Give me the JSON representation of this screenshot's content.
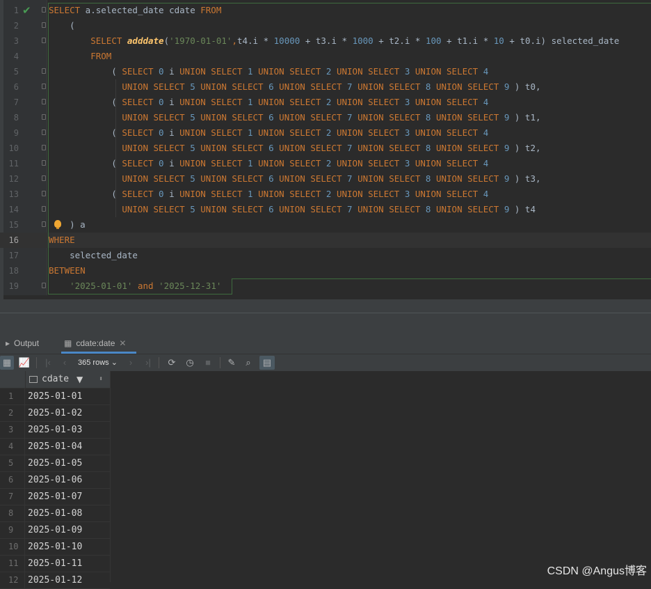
{
  "editor": {
    "lines": [
      {
        "n": "1",
        "tokens": [
          {
            "t": "SELECT",
            "c": "kw"
          },
          {
            "t": " a.selected_date cdate "
          },
          {
            "t": "FROM",
            "c": "kw"
          }
        ]
      },
      {
        "n": "2",
        "tokens": [
          {
            "t": "    ("
          }
        ]
      },
      {
        "n": "3",
        "tokens": [
          {
            "t": "        "
          },
          {
            "t": "SELECT",
            "c": "kw"
          },
          {
            "t": " "
          },
          {
            "t": "adddate",
            "c": "fn"
          },
          {
            "t": "("
          },
          {
            "t": "'1970-01-01'",
            "c": "str"
          },
          {
            "t": ",",
            "c": "kw"
          },
          {
            "t": "t4.i * "
          },
          {
            "t": "10000",
            "c": "num"
          },
          {
            "t": " + t3.i * "
          },
          {
            "t": "1000",
            "c": "num"
          },
          {
            "t": " + t2.i * "
          },
          {
            "t": "100",
            "c": "num"
          },
          {
            "t": " + t1.i * "
          },
          {
            "t": "10",
            "c": "num"
          },
          {
            "t": " + t0.i) selected_date"
          }
        ]
      },
      {
        "n": "4",
        "tokens": [
          {
            "t": "        "
          },
          {
            "t": "FROM",
            "c": "kw"
          }
        ]
      },
      {
        "n": "5",
        "tokens": [
          {
            "t": "            ( "
          },
          {
            "t": "SELECT",
            "c": "kw"
          },
          {
            "t": " "
          },
          {
            "t": "0",
            "c": "num"
          },
          {
            "t": " i "
          },
          {
            "t": "UNION SELECT",
            "c": "kw"
          },
          {
            "t": " "
          },
          {
            "t": "1",
            "c": "num"
          },
          {
            "t": " "
          },
          {
            "t": "UNION SELECT",
            "c": "kw"
          },
          {
            "t": " "
          },
          {
            "t": "2",
            "c": "num"
          },
          {
            "t": " "
          },
          {
            "t": "UNION SELECT",
            "c": "kw"
          },
          {
            "t": " "
          },
          {
            "t": "3",
            "c": "num"
          },
          {
            "t": " "
          },
          {
            "t": "UNION SELECT",
            "c": "kw"
          },
          {
            "t": " "
          },
          {
            "t": "4",
            "c": "num"
          }
        ]
      },
      {
        "n": "6",
        "tokens": [
          {
            "t": "              "
          },
          {
            "t": "UNION SELECT",
            "c": "kw"
          },
          {
            "t": " "
          },
          {
            "t": "5",
            "c": "num"
          },
          {
            "t": " "
          },
          {
            "t": "UNION SELECT",
            "c": "kw"
          },
          {
            "t": " "
          },
          {
            "t": "6",
            "c": "num"
          },
          {
            "t": " "
          },
          {
            "t": "UNION SELECT",
            "c": "kw"
          },
          {
            "t": " "
          },
          {
            "t": "7",
            "c": "num"
          },
          {
            "t": " "
          },
          {
            "t": "UNION SELECT",
            "c": "kw"
          },
          {
            "t": " "
          },
          {
            "t": "8",
            "c": "num"
          },
          {
            "t": " "
          },
          {
            "t": "UNION SELECT",
            "c": "kw"
          },
          {
            "t": " "
          },
          {
            "t": "9",
            "c": "num"
          },
          {
            "t": " ) t0,"
          }
        ]
      },
      {
        "n": "7",
        "tokens": [
          {
            "t": "            ( "
          },
          {
            "t": "SELECT",
            "c": "kw"
          },
          {
            "t": " "
          },
          {
            "t": "0",
            "c": "num"
          },
          {
            "t": " i "
          },
          {
            "t": "UNION SELECT",
            "c": "kw"
          },
          {
            "t": " "
          },
          {
            "t": "1",
            "c": "num"
          },
          {
            "t": " "
          },
          {
            "t": "UNION SELECT",
            "c": "kw"
          },
          {
            "t": " "
          },
          {
            "t": "2",
            "c": "num"
          },
          {
            "t": " "
          },
          {
            "t": "UNION SELECT",
            "c": "kw"
          },
          {
            "t": " "
          },
          {
            "t": "3",
            "c": "num"
          },
          {
            "t": " "
          },
          {
            "t": "UNION SELECT",
            "c": "kw"
          },
          {
            "t": " "
          },
          {
            "t": "4",
            "c": "num"
          }
        ]
      },
      {
        "n": "8",
        "tokens": [
          {
            "t": "              "
          },
          {
            "t": "UNION SELECT",
            "c": "kw"
          },
          {
            "t": " "
          },
          {
            "t": "5",
            "c": "num"
          },
          {
            "t": " "
          },
          {
            "t": "UNION SELECT",
            "c": "kw"
          },
          {
            "t": " "
          },
          {
            "t": "6",
            "c": "num"
          },
          {
            "t": " "
          },
          {
            "t": "UNION SELECT",
            "c": "kw"
          },
          {
            "t": " "
          },
          {
            "t": "7",
            "c": "num"
          },
          {
            "t": " "
          },
          {
            "t": "UNION SELECT",
            "c": "kw"
          },
          {
            "t": " "
          },
          {
            "t": "8",
            "c": "num"
          },
          {
            "t": " "
          },
          {
            "t": "UNION SELECT",
            "c": "kw"
          },
          {
            "t": " "
          },
          {
            "t": "9",
            "c": "num"
          },
          {
            "t": " ) t1,"
          }
        ]
      },
      {
        "n": "9",
        "tokens": [
          {
            "t": "            ( "
          },
          {
            "t": "SELECT",
            "c": "kw"
          },
          {
            "t": " "
          },
          {
            "t": "0",
            "c": "num"
          },
          {
            "t": " i "
          },
          {
            "t": "UNION SELECT",
            "c": "kw"
          },
          {
            "t": " "
          },
          {
            "t": "1",
            "c": "num"
          },
          {
            "t": " "
          },
          {
            "t": "UNION SELECT",
            "c": "kw"
          },
          {
            "t": " "
          },
          {
            "t": "2",
            "c": "num"
          },
          {
            "t": " "
          },
          {
            "t": "UNION SELECT",
            "c": "kw"
          },
          {
            "t": " "
          },
          {
            "t": "3",
            "c": "num"
          },
          {
            "t": " "
          },
          {
            "t": "UNION SELECT",
            "c": "kw"
          },
          {
            "t": " "
          },
          {
            "t": "4",
            "c": "num"
          }
        ]
      },
      {
        "n": "10",
        "tokens": [
          {
            "t": "              "
          },
          {
            "t": "UNION SELECT",
            "c": "kw"
          },
          {
            "t": " "
          },
          {
            "t": "5",
            "c": "num"
          },
          {
            "t": " "
          },
          {
            "t": "UNION SELECT",
            "c": "kw"
          },
          {
            "t": " "
          },
          {
            "t": "6",
            "c": "num"
          },
          {
            "t": " "
          },
          {
            "t": "UNION SELECT",
            "c": "kw"
          },
          {
            "t": " "
          },
          {
            "t": "7",
            "c": "num"
          },
          {
            "t": " "
          },
          {
            "t": "UNION SELECT",
            "c": "kw"
          },
          {
            "t": " "
          },
          {
            "t": "8",
            "c": "num"
          },
          {
            "t": " "
          },
          {
            "t": "UNION SELECT",
            "c": "kw"
          },
          {
            "t": " "
          },
          {
            "t": "9",
            "c": "num"
          },
          {
            "t": " ) t2,"
          }
        ]
      },
      {
        "n": "11",
        "tokens": [
          {
            "t": "            ( "
          },
          {
            "t": "SELECT",
            "c": "kw"
          },
          {
            "t": " "
          },
          {
            "t": "0",
            "c": "num"
          },
          {
            "t": " i "
          },
          {
            "t": "UNION SELECT",
            "c": "kw"
          },
          {
            "t": " "
          },
          {
            "t": "1",
            "c": "num"
          },
          {
            "t": " "
          },
          {
            "t": "UNION SELECT",
            "c": "kw"
          },
          {
            "t": " "
          },
          {
            "t": "2",
            "c": "num"
          },
          {
            "t": " "
          },
          {
            "t": "UNION SELECT",
            "c": "kw"
          },
          {
            "t": " "
          },
          {
            "t": "3",
            "c": "num"
          },
          {
            "t": " "
          },
          {
            "t": "UNION SELECT",
            "c": "kw"
          },
          {
            "t": " "
          },
          {
            "t": "4",
            "c": "num"
          }
        ]
      },
      {
        "n": "12",
        "tokens": [
          {
            "t": "              "
          },
          {
            "t": "UNION SELECT",
            "c": "kw"
          },
          {
            "t": " "
          },
          {
            "t": "5",
            "c": "num"
          },
          {
            "t": " "
          },
          {
            "t": "UNION SELECT",
            "c": "kw"
          },
          {
            "t": " "
          },
          {
            "t": "6",
            "c": "num"
          },
          {
            "t": " "
          },
          {
            "t": "UNION SELECT",
            "c": "kw"
          },
          {
            "t": " "
          },
          {
            "t": "7",
            "c": "num"
          },
          {
            "t": " "
          },
          {
            "t": "UNION SELECT",
            "c": "kw"
          },
          {
            "t": " "
          },
          {
            "t": "8",
            "c": "num"
          },
          {
            "t": " "
          },
          {
            "t": "UNION SELECT",
            "c": "kw"
          },
          {
            "t": " "
          },
          {
            "t": "9",
            "c": "num"
          },
          {
            "t": " ) t3,"
          }
        ]
      },
      {
        "n": "13",
        "tokens": [
          {
            "t": "            ( "
          },
          {
            "t": "SELECT",
            "c": "kw"
          },
          {
            "t": " "
          },
          {
            "t": "0",
            "c": "num"
          },
          {
            "t": " i "
          },
          {
            "t": "UNION SELECT",
            "c": "kw"
          },
          {
            "t": " "
          },
          {
            "t": "1",
            "c": "num"
          },
          {
            "t": " "
          },
          {
            "t": "UNION SELECT",
            "c": "kw"
          },
          {
            "t": " "
          },
          {
            "t": "2",
            "c": "num"
          },
          {
            "t": " "
          },
          {
            "t": "UNION SELECT",
            "c": "kw"
          },
          {
            "t": " "
          },
          {
            "t": "3",
            "c": "num"
          },
          {
            "t": " "
          },
          {
            "t": "UNION SELECT",
            "c": "kw"
          },
          {
            "t": " "
          },
          {
            "t": "4",
            "c": "num"
          }
        ]
      },
      {
        "n": "14",
        "tokens": [
          {
            "t": "              "
          },
          {
            "t": "UNION SELECT",
            "c": "kw"
          },
          {
            "t": " "
          },
          {
            "t": "5",
            "c": "num"
          },
          {
            "t": " "
          },
          {
            "t": "UNION SELECT",
            "c": "kw"
          },
          {
            "t": " "
          },
          {
            "t": "6",
            "c": "num"
          },
          {
            "t": " "
          },
          {
            "t": "UNION SELECT",
            "c": "kw"
          },
          {
            "t": " "
          },
          {
            "t": "7",
            "c": "num"
          },
          {
            "t": " "
          },
          {
            "t": "UNION SELECT",
            "c": "kw"
          },
          {
            "t": " "
          },
          {
            "t": "8",
            "c": "num"
          },
          {
            "t": " "
          },
          {
            "t": "UNION SELECT",
            "c": "kw"
          },
          {
            "t": " "
          },
          {
            "t": "9",
            "c": "num"
          },
          {
            "t": " ) t4"
          }
        ]
      },
      {
        "n": "15",
        "tokens": [
          {
            "t": "    ) a"
          }
        ]
      },
      {
        "n": "16",
        "tokens": [
          {
            "t": "WHERE",
            "c": "kw"
          }
        ]
      },
      {
        "n": "17",
        "tokens": [
          {
            "t": "    selected_date"
          }
        ]
      },
      {
        "n": "18",
        "tokens": [
          {
            "t": "BETWEEN",
            "c": "kw"
          }
        ]
      },
      {
        "n": "19",
        "tokens": [
          {
            "t": "    "
          },
          {
            "t": "'2025-01-01'",
            "c": "str"
          },
          {
            "t": " "
          },
          {
            "t": "and",
            "c": "kw"
          },
          {
            "t": " "
          },
          {
            "t": "'2025-12-31'",
            "c": "str"
          }
        ]
      }
    ],
    "current_line": "16"
  },
  "tabs": {
    "output_label": "Output",
    "result_label": "cdate:date"
  },
  "toolbar": {
    "rows_label": "365 rows"
  },
  "grid": {
    "column_header": "cdate",
    "rows": [
      {
        "n": "1",
        "v": "2025-01-01"
      },
      {
        "n": "2",
        "v": "2025-01-02"
      },
      {
        "n": "3",
        "v": "2025-01-03"
      },
      {
        "n": "4",
        "v": "2025-01-04"
      },
      {
        "n": "5",
        "v": "2025-01-05"
      },
      {
        "n": "6",
        "v": "2025-01-06"
      },
      {
        "n": "7",
        "v": "2025-01-07"
      },
      {
        "n": "8",
        "v": "2025-01-08"
      },
      {
        "n": "9",
        "v": "2025-01-09"
      },
      {
        "n": "10",
        "v": "2025-01-10"
      },
      {
        "n": "11",
        "v": "2025-01-11"
      },
      {
        "n": "12",
        "v": "2025-01-12"
      }
    ]
  },
  "watermark": "CSDN @Angus博客",
  "colors": {
    "keyword": "#cc7832",
    "number": "#6897bb",
    "string": "#6a8759",
    "function": "#ffc66d",
    "text": "#a9b7c6",
    "background": "#2b2b2b",
    "accent": "#4a88c7"
  }
}
